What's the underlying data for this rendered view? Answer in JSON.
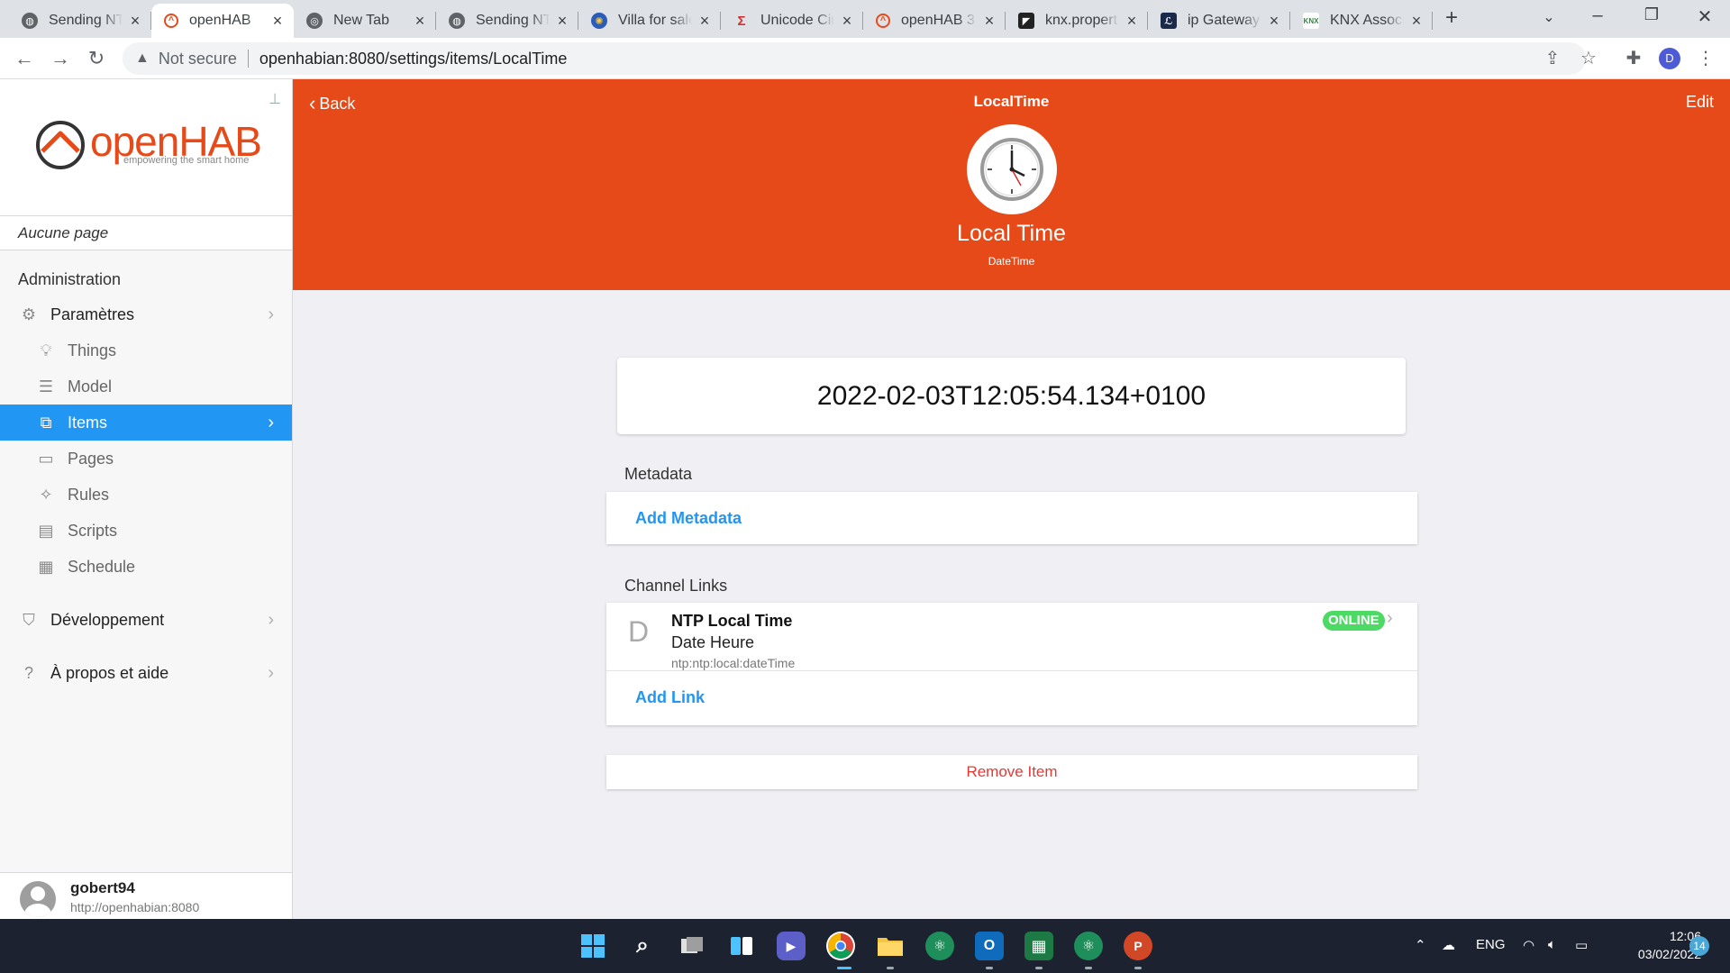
{
  "browser": {
    "tabs": [
      {
        "title": "Sending NTP",
        "active": false
      },
      {
        "title": "openHAB",
        "active": true
      },
      {
        "title": "New Tab",
        "active": false
      },
      {
        "title": "Sending NTP",
        "active": false
      },
      {
        "title": "Villa for sale",
        "active": false
      },
      {
        "title": "Unicode Cir",
        "active": false
      },
      {
        "title": "openHAB 3",
        "active": false
      },
      {
        "title": "knx.propert",
        "active": false
      },
      {
        "title": "ip Gateway",
        "active": false
      },
      {
        "title": "KNX Associ",
        "active": false
      }
    ],
    "security_label": "Not secure",
    "url": "openhabian:8080/settings/items/LocalTime",
    "profile_initial": "D"
  },
  "sidebar": {
    "logo_text": "openHAB",
    "logo_tagline": "empowering the smart home",
    "current_page": "Aucune page",
    "section_title": "Administration",
    "settings_label": "Paramètres",
    "sub_items": [
      {
        "label": "Things",
        "icon": "lightbulb-icon"
      },
      {
        "label": "Model",
        "icon": "list-icon"
      },
      {
        "label": "Items",
        "icon": "items-icon",
        "selected": true
      },
      {
        "label": "Pages",
        "icon": "monitor-icon"
      },
      {
        "label": "Rules",
        "icon": "wand-icon"
      },
      {
        "label": "Scripts",
        "icon": "script-icon"
      },
      {
        "label": "Schedule",
        "icon": "calendar-icon"
      }
    ],
    "dev_label": "Développement",
    "help_label": "À propos et aide",
    "user_name": "gobert94",
    "user_url": "http://openhabian:8080"
  },
  "header": {
    "back_label": "Back",
    "title": "LocalTime",
    "edit_label": "Edit",
    "item_label": "Local Time",
    "item_type": "DateTime"
  },
  "content": {
    "state": "2022-02-03T12:05:54.134+0100",
    "metadata_title": "Metadata",
    "add_metadata": "Add Metadata",
    "channel_links_title": "Channel Links",
    "channel": {
      "letter": "D",
      "name": "NTP Local Time",
      "label": "Date Heure",
      "uid": "ntp:ntp:local:dateTime",
      "status": "ONLINE"
    },
    "add_link": "Add Link",
    "remove_item": "Remove Item"
  },
  "colors": {
    "accent": "#e64a19",
    "selection": "#2196f3",
    "online": "#4cd964",
    "danger": "#e53935"
  },
  "taskbar": {
    "language": "ENG",
    "time": "12:06",
    "date": "03/02/2022",
    "notifications": "14"
  }
}
